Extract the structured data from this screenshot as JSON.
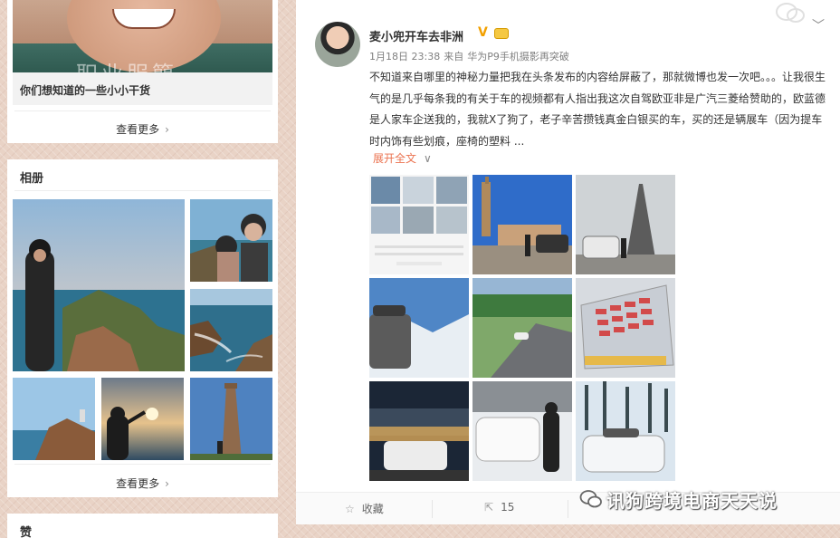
{
  "left": {
    "articles": {
      "thumb_overlay_text": "职业服簡",
      "caption": "你们想知道的一些小小干货",
      "see_more": "查看更多"
    },
    "album": {
      "title": "相册",
      "see_more": "查看更多"
    },
    "likes": {
      "title": "赞"
    }
  },
  "post": {
    "username": "麦小兜开车去非洲",
    "date": "1月18日 23:38",
    "source_prefix": "来自",
    "source": "华为P9手机摄影再突破",
    "text": "不知道来自哪里的神秘力量把我在头条发布的内容给屏蔽了，那就微博也发一次吧。。。让我很生气的是几乎每条我的有关于车的视频都有人指出我这次自驾欧亚非是广汽三菱给赞助的，欧蓝德是人家车企送我的，我就X了狗了，老子辛苦攒钱真金白银买的车，买的还是辆展车（因为提车时内饰有些划痕，座椅的塑料 ...",
    "expand_label": "展开全文",
    "actions": {
      "favorite": "收藏",
      "repost_count": "15"
    }
  },
  "watermark": "讯狗跨境电商天天说",
  "icons": {
    "verified": "verified-v-icon",
    "level": "level-badge-icon",
    "more": "chevron-down-icon",
    "favorite": "star-icon",
    "repost": "repost-icon",
    "watermark": "wechat-icon"
  },
  "colors": {
    "accent_orange": "#eb7350",
    "verified_gold": "#f2a000",
    "background": "#e9d3c6"
  }
}
